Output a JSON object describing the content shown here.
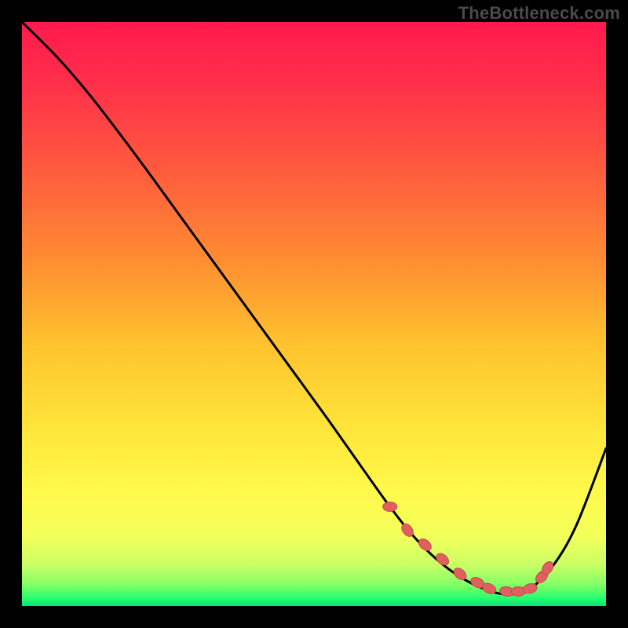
{
  "watermark": "TheBottleneck.com",
  "colors": {
    "background": "#000000",
    "gradient_stops": [
      {
        "offset": 0.0,
        "color": "#ff1a4d"
      },
      {
        "offset": 0.1,
        "color": "#ff2e4a"
      },
      {
        "offset": 0.25,
        "color": "#ff5a3e"
      },
      {
        "offset": 0.4,
        "color": "#ff8a33"
      },
      {
        "offset": 0.55,
        "color": "#ffc22e"
      },
      {
        "offset": 0.7,
        "color": "#ffe63a"
      },
      {
        "offset": 0.8,
        "color": "#fff94a"
      },
      {
        "offset": 0.88,
        "color": "#f4ff5a"
      },
      {
        "offset": 0.93,
        "color": "#c9ff66"
      },
      {
        "offset": 0.965,
        "color": "#7fff66"
      },
      {
        "offset": 0.985,
        "color": "#2dff6e"
      },
      {
        "offset": 1.0,
        "color": "#00e676"
      }
    ],
    "curve": "#000000",
    "marker_fill": "#e06060",
    "marker_stroke": "#c24b4b"
  },
  "chart_data": {
    "type": "line",
    "title": "",
    "xlabel": "",
    "ylabel": "",
    "xlim": [
      0,
      100
    ],
    "ylim": [
      0,
      100
    ],
    "series": [
      {
        "name": "bottleneck-curve",
        "x": [
          0,
          6,
          12,
          20,
          28,
          36,
          44,
          52,
          58,
          63,
          67,
          71,
          75,
          79,
          83,
          87,
          91,
          95,
          100
        ],
        "y": [
          100,
          94,
          87,
          76.5,
          65.5,
          54.5,
          43.5,
          32.5,
          24,
          17,
          12,
          8,
          5,
          3,
          2,
          3,
          7,
          14,
          27
        ]
      }
    ],
    "markers": {
      "name": "highlight-points",
      "x": [
        63,
        66,
        69,
        72,
        75,
        78,
        80,
        83,
        85,
        87,
        89,
        90
      ],
      "y": [
        17,
        13,
        10.5,
        8,
        5.5,
        4,
        3,
        2.5,
        2.5,
        3,
        5,
        6.5
      ]
    }
  }
}
